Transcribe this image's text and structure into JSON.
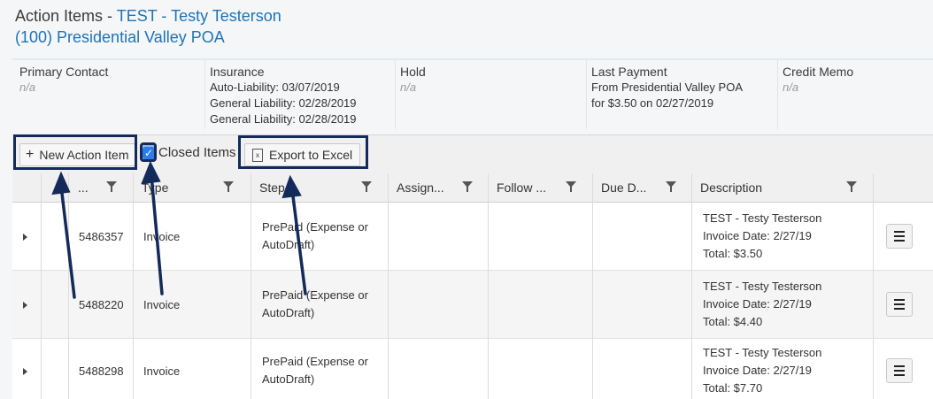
{
  "header": {
    "title_prefix": "Action Items - ",
    "title_link": "TEST - Testy Testerson",
    "subtitle": "(100) Presidential Valley POA"
  },
  "info": {
    "primary_contact": {
      "label": "Primary Contact",
      "value": "n/a"
    },
    "insurance": {
      "label": "Insurance",
      "lines": [
        "Auto-Liability: 03/07/2019",
        "General Liability: 02/28/2019",
        "General Liability: 02/28/2019"
      ]
    },
    "hold": {
      "label": "Hold",
      "value": "n/a"
    },
    "last_payment": {
      "label": "Last Payment",
      "lines": [
        "From Presidential Valley POA",
        "for $3.50 on 02/27/2019"
      ]
    },
    "credit_memo": {
      "label": "Credit Memo",
      "value": "n/a"
    }
  },
  "toolbar": {
    "new_action_label": "New Action Item",
    "closed_items_label": "Closed Items",
    "closed_items_checked": true,
    "export_label": "Export to Excel"
  },
  "grid": {
    "columns": [
      "...",
      "Type",
      "Step",
      "Assign...",
      "Follow ...",
      "Due D...",
      "Description"
    ],
    "rows": [
      {
        "id": "5486357",
        "type": "Invoice",
        "step": "PrePaid (Expense or AutoDraft)",
        "desc": [
          "TEST - Testy Testerson",
          "Invoice Date: 2/27/19",
          "Total: $3.50"
        ]
      },
      {
        "id": "5488220",
        "type": "Invoice",
        "step": "PrePaid (Expense or AutoDraft)",
        "desc": [
          "TEST - Testy Testerson",
          "Invoice Date: 2/27/19",
          "Total: $4.40"
        ]
      },
      {
        "id": "5488298",
        "type": "Invoice",
        "step": "PrePaid (Expense or AutoDraft)",
        "desc": [
          "TEST - Testy Testerson",
          "Invoice Date: 2/27/19",
          "Total: $7.70"
        ]
      }
    ]
  },
  "colors": {
    "link": "#1f73b7",
    "highlight": "#132a5a",
    "checkbox": "#2b7de9"
  }
}
